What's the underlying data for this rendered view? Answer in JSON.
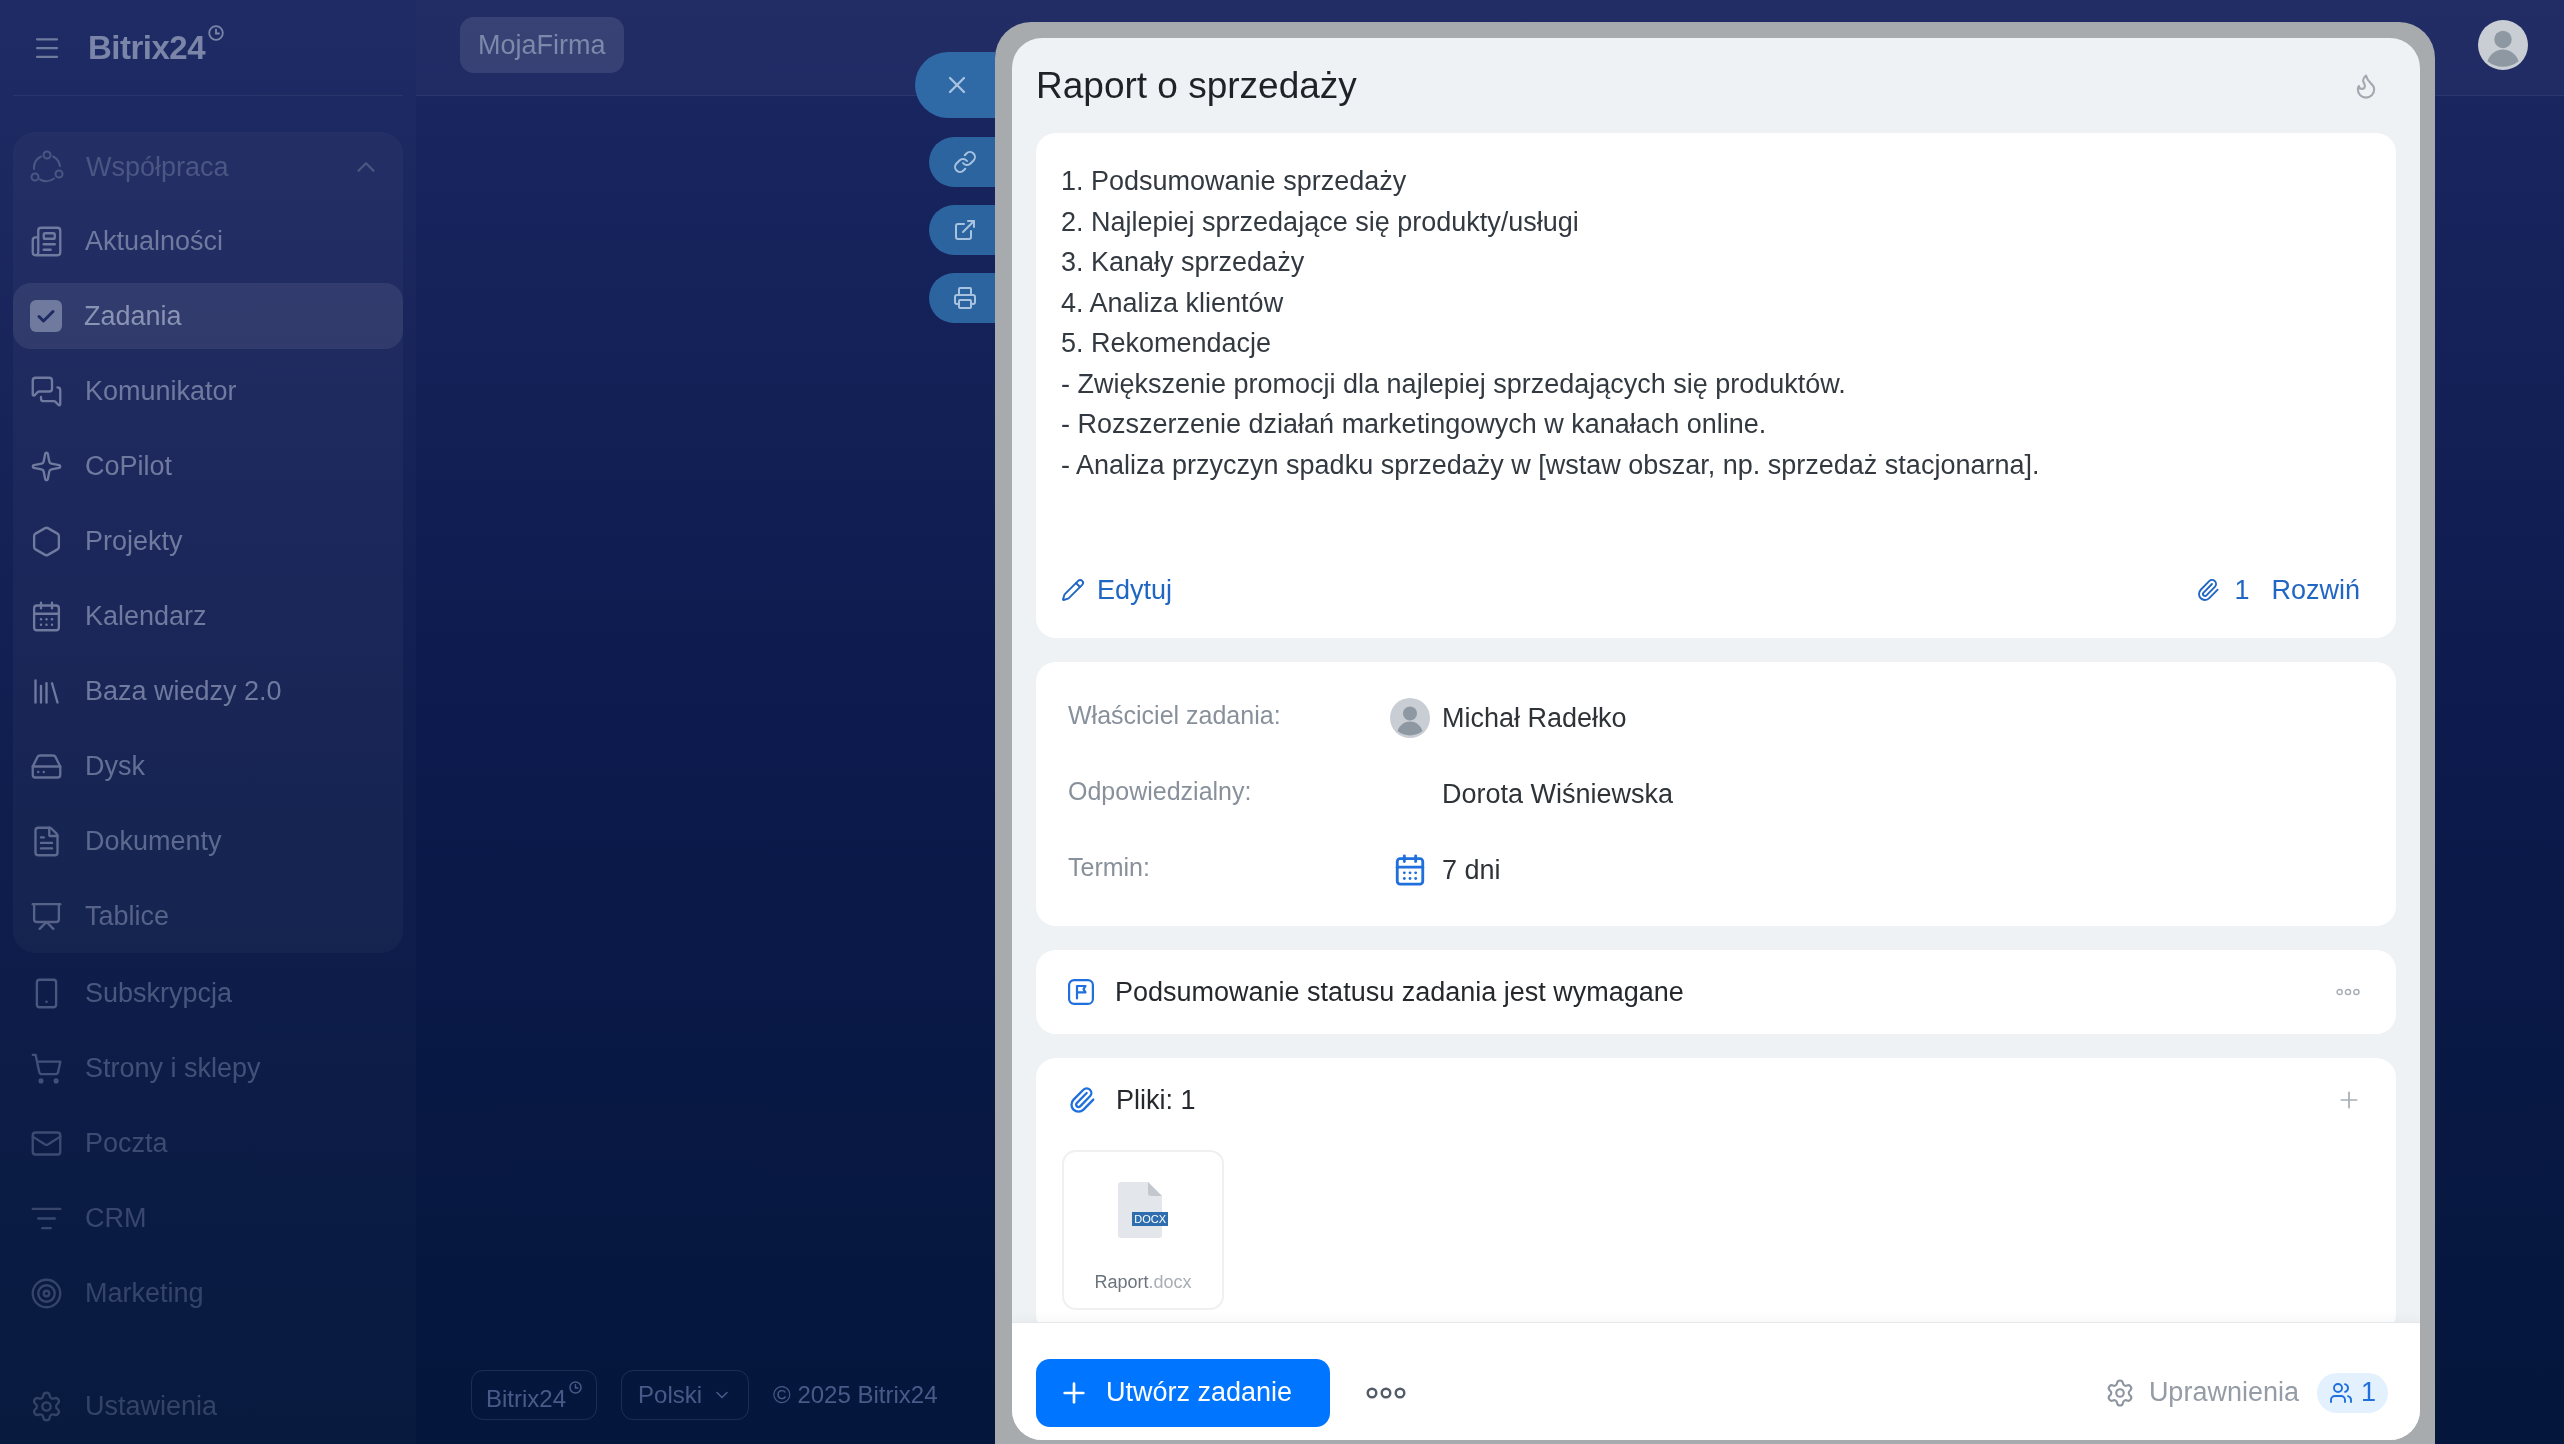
{
  "sidebar": {
    "logo": "Bitrix24",
    "group": {
      "label": "Współpraca",
      "expanded": true,
      "items": [
        {
          "label": "Aktualności",
          "selected": false
        },
        {
          "label": "Zadania",
          "selected": true
        },
        {
          "label": "Komunikator",
          "selected": false
        },
        {
          "label": "CoPilot",
          "selected": false
        },
        {
          "label": "Projekty",
          "selected": false
        },
        {
          "label": "Kalendarz",
          "selected": false
        },
        {
          "label": "Baza wiedzy 2.0",
          "selected": false
        },
        {
          "label": "Dysk",
          "selected": false
        },
        {
          "label": "Dokumenty",
          "selected": false
        },
        {
          "label": "Tablice",
          "selected": false
        }
      ]
    },
    "items": [
      {
        "label": "Subskrypcja",
        "selected": false
      },
      {
        "label": "Strony i sklepy",
        "selected": false
      },
      {
        "label": "Poczta",
        "selected": false
      },
      {
        "label": "CRM",
        "selected": false
      },
      {
        "label": "Marketing",
        "selected": false
      }
    ],
    "settings": "Ustawienia"
  },
  "top_bar": {
    "company_button": "MojaFirma"
  },
  "page_footer": {
    "brand_button": "Bitrix24",
    "language_button": "Polski",
    "copyright": "© 2025 Bitrix24"
  },
  "task_panel": {
    "title": "Raport o sprzedaży",
    "description": {
      "lines": [
        "1. Podsumowanie sprzedaży",
        "2. Najlepiej sprzedające się produkty/usługi",
        "3. Kanały sprzedaży",
        "4. Analiza klientów",
        "5. Rekomendacje",
        "- Zwiększenie promocji dla najlepiej sprzedających się produktów.",
        "- Rozszerzenie działań marketingowych w kanałach online.",
        "- Analiza przyczyn spadku sprzedaży w [wstaw obszar, np. sprzedaż stacjonarna]."
      ],
      "edit_link": "Edytuj",
      "attachments_count": "1",
      "expand_link": "Rozwiń"
    },
    "details": [
      {
        "kind": "person",
        "label": "Właściciel zadania:",
        "value": "Michał Radełko",
        "avatar": true
      },
      {
        "kind": "person",
        "label": "Odpowiedzialny:",
        "value": "Dorota Wiśniewska",
        "avatar": false
      },
      {
        "kind": "deadline",
        "label": "Termin:",
        "value": "7 dni"
      }
    ],
    "requirement": "Podsumowanie statusu zadania jest wymagane",
    "files": {
      "title": "Pliki: 1",
      "items": [
        {
          "name": "Raport",
          "extension": ".docx",
          "type_label": "DOCX"
        }
      ]
    },
    "footer": {
      "create_button": "Utwórz zadanie",
      "permissions_button": "Uprawnienia",
      "members_count": "1"
    }
  }
}
